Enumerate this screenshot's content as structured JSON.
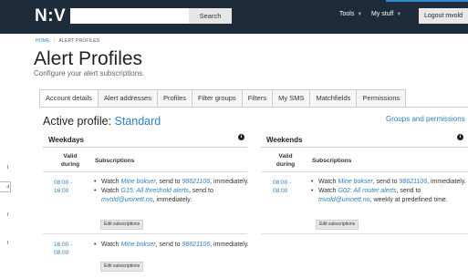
{
  "header": {
    "logo": "N:V",
    "search_placeholder": "",
    "search_button": "Search",
    "tools": "Tools",
    "my_stuff": "My stuff",
    "caret": "▼",
    "logout": "Logout mvold"
  },
  "breadcrumb": {
    "home": "HOME",
    "separator": "/",
    "current": "ALERT PROFILES"
  },
  "page": {
    "title": "Alert Profiles",
    "subtitle": "Configure your alert subscriptions."
  },
  "tabs": [
    "Account details",
    "Alert addresses",
    "Profiles",
    "Filter groups",
    "Filters",
    "My SMS",
    "Matchfields",
    "Permissions"
  ],
  "active_tab": "Account details",
  "profile": {
    "label": "Active profile: ",
    "name": "Standard",
    "groups_link": "Groups and permissions"
  },
  "columns": {
    "valid_during": "Valid during",
    "subscriptions": "Subscriptions"
  },
  "weekdays": {
    "title": "Weekdays",
    "info": "i",
    "rows": [
      {
        "time": "08:00 - 16:00",
        "subs": [
          {
            "pre": "Watch ",
            "link": "Mine bokser",
            "mid": ", send to ",
            "link2": "98621106",
            "post": ", immediately."
          },
          {
            "pre": "Watch ",
            "link": "G15: All threshold alerts",
            "mid": ", send to ",
            "link2": "mvold@uninett.no",
            "post": ", immediately."
          }
        ],
        "edit": "Edit subscriptions"
      },
      {
        "time": "16:00 - 08:00",
        "subs": [
          {
            "pre": "Watch ",
            "link": "Mine bokser",
            "mid": ", send to ",
            "link2": "98621106",
            "post": ", immediately."
          }
        ],
        "edit": "Edit subscriptions"
      }
    ]
  },
  "weekends": {
    "title": "Weekends",
    "info": "i",
    "rows": [
      {
        "time": "08:00 - 08:00",
        "subs": [
          {
            "pre": "Watch ",
            "link": "Mine bokser",
            "mid": ", send to ",
            "link2": "98621106",
            "post": ", immediately."
          },
          {
            "pre": "Watch ",
            "link": "G02: All router alerts",
            "mid": ", send to ",
            "link2": "mvold@uninett.no",
            "post": ", weekly at predefined time."
          }
        ],
        "edit": "Edit subscriptions"
      }
    ]
  },
  "left_sliver": "d",
  "colors": {
    "topbar": "#1d2b3a",
    "link": "#2f7fc0",
    "accent": "#2f8ad0"
  }
}
